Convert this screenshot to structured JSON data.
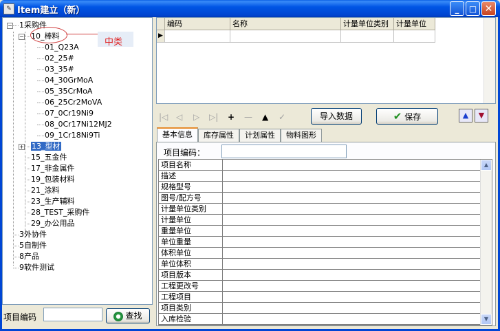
{
  "window": {
    "title": "Item建立（新）",
    "icon_name": "app-icon",
    "controls": [
      "minimize-icon",
      "maximize-icon",
      "close-icon"
    ]
  },
  "tree": {
    "nodes": [
      {
        "label": "1采购件",
        "level": 0,
        "expanded": true
      },
      {
        "label": "10_棒料",
        "level": 1,
        "expanded": true
      },
      {
        "label": "01_Q23A",
        "level": 2
      },
      {
        "label": "02_25#",
        "level": 2
      },
      {
        "label": "03_35#",
        "level": 2
      },
      {
        "label": "04_30GrMoA",
        "level": 2
      },
      {
        "label": "05_35CrMoA",
        "level": 2
      },
      {
        "label": "06_25Cr2MoVA",
        "level": 2
      },
      {
        "label": "07_0Cr19Ni9",
        "level": 2
      },
      {
        "label": "08_0Cr17Ni12MJ2",
        "level": 2
      },
      {
        "label": "09_1Cr18Ni9Ti",
        "level": 2
      },
      {
        "label": "13_型材",
        "level": 1,
        "expanded": false,
        "selected": true
      },
      {
        "label": "15_五金件",
        "level": 1
      },
      {
        "label": "17_非金属件",
        "level": 1
      },
      {
        "label": "19_包装材料",
        "level": 1
      },
      {
        "label": "21_涂料",
        "level": 1
      },
      {
        "label": "23_生产辅料",
        "level": 1
      },
      {
        "label": "28_TEST_采购件",
        "level": 1
      },
      {
        "label": "29_办公用品",
        "level": 1
      },
      {
        "label": "3外协件",
        "level": 0
      },
      {
        "label": "5自制件",
        "level": 0
      },
      {
        "label": "8产品",
        "level": 0
      },
      {
        "label": "9软件测试",
        "level": 0
      }
    ],
    "annotation": "中类",
    "annotation_color": "#e02020"
  },
  "search": {
    "label": "项目编码",
    "value": "",
    "button_label": "查找",
    "button_icon": "refresh-icon"
  },
  "grid": {
    "columns": [
      "编码",
      "名称",
      "计量单位类别",
      "计量单位"
    ],
    "rows": [
      [
        "",
        "",
        "",
        ""
      ]
    ]
  },
  "toolbar": {
    "nav_icons": [
      "first-record-icon",
      "prev-record-icon",
      "next-record-icon",
      "last-record-icon",
      "add-icon",
      "delete-icon",
      "up-icon",
      "confirm-icon"
    ],
    "import_label": "导入数据",
    "save_label": "保存",
    "save_icon": "checkmark-icon",
    "move_up_icon": "arrow-up-icon",
    "move_down_icon": "arrow-down-icon"
  },
  "tabs": [
    {
      "label": "基本信息",
      "active": true
    },
    {
      "label": "库存属性",
      "active": false
    },
    {
      "label": "计划属性",
      "active": false
    },
    {
      "label": "物料图形",
      "active": false
    }
  ],
  "form": {
    "code_label": "项目编码：",
    "code_value": "",
    "properties": [
      "项目名称",
      "描述",
      "规格型号",
      "图号/配方号",
      "计量单位类别",
      "计量单位",
      "重量单位",
      "单位重量",
      "体积单位",
      "单位体积",
      "项目版本",
      "工程更改号",
      "工程项目",
      "项目类别",
      "入库检验"
    ]
  },
  "colors": {
    "titlebar": "#0055E5",
    "selection": "#316AC5",
    "window_bg": "#ECE9D8"
  }
}
